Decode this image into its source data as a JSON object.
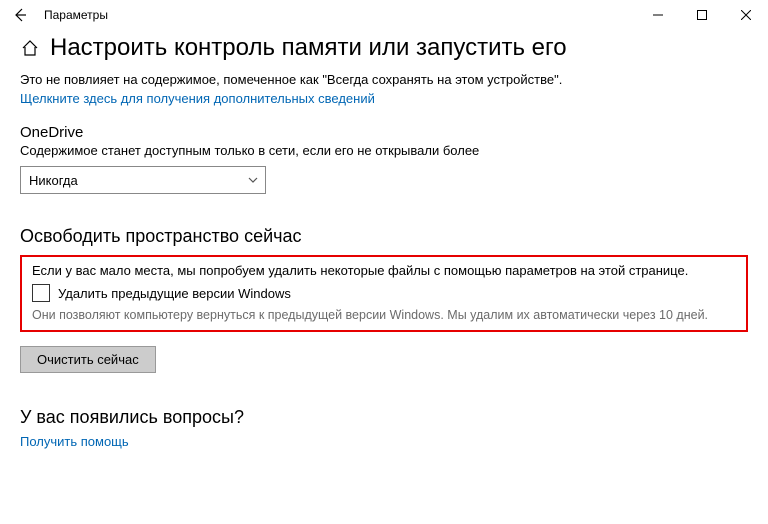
{
  "window": {
    "title": "Параметры"
  },
  "page": {
    "heading": "Настроить контроль памяти или запустить его",
    "description": "Это не повлияет на содержимое, помеченное как \"Всегда сохранять на этом устройстве\".",
    "more_link": "Щелкните здесь для получения дополнительных сведений"
  },
  "onedrive": {
    "label": "OneDrive",
    "subtext": "Содержимое станет доступным только в сети, если его не открывали более",
    "dropdown_value": "Никогда"
  },
  "freeup": {
    "title": "Освободить пространство сейчас",
    "intro": "Если у вас мало места, мы попробуем удалить некоторые файлы с помощью параметров на этой странице.",
    "checkbox_label": "Удалить предыдущие версии Windows",
    "note": "Они позволяют компьютеру вернуться к предыдущей версии Windows. Мы удалим их автоматически через 10 дней.",
    "button": "Очистить сейчас"
  },
  "help": {
    "title": "У вас появились вопросы?",
    "link": "Получить помощь"
  }
}
